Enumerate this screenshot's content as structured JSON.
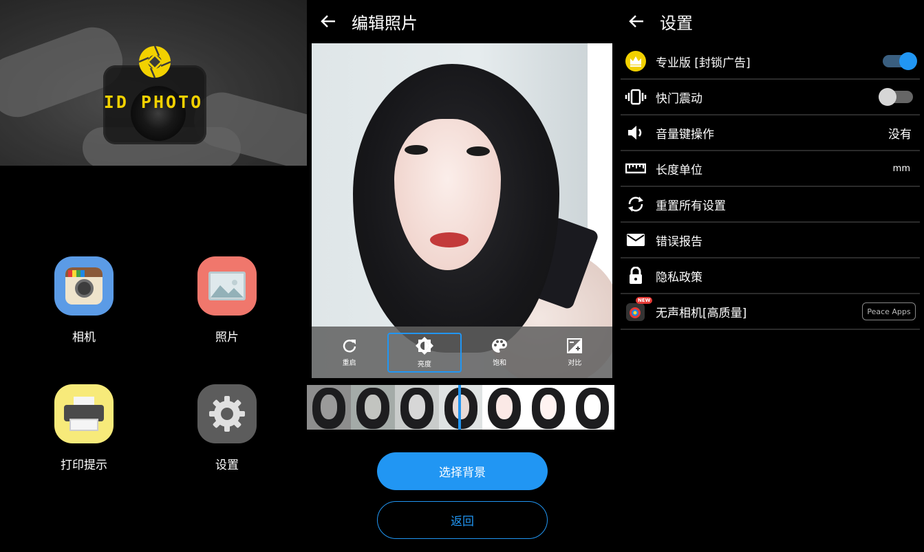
{
  "home": {
    "logo_text": "ID PHOTO",
    "apps": [
      {
        "label": "相机",
        "icon": "camera-app-icon"
      },
      {
        "label": "照片",
        "icon": "photos-app-icon"
      },
      {
        "label": "打印提示",
        "icon": "printer-app-icon"
      },
      {
        "label": "设置",
        "icon": "settings-app-icon"
      }
    ]
  },
  "editor": {
    "title": "编辑照片",
    "tools": [
      {
        "label": "重启",
        "icon": "reset-icon"
      },
      {
        "label": "亮度",
        "icon": "brightness-icon",
        "active": true
      },
      {
        "label": "饱和",
        "icon": "palette-icon"
      },
      {
        "label": "对比",
        "icon": "contrast-icon"
      }
    ],
    "filters_count": 7,
    "select_bg_label": "选择背景",
    "back_label": "返回"
  },
  "settings": {
    "title": "设置",
    "rows": [
      {
        "label": "专业版 [封锁广告]",
        "icon": "crown-icon",
        "control": "toggle",
        "on": true
      },
      {
        "label": "快门震动",
        "icon": "vibrate-icon",
        "control": "toggle",
        "on": false
      },
      {
        "label": "音量键操作",
        "icon": "volume-icon",
        "value": "没有"
      },
      {
        "label": "长度单位",
        "icon": "ruler-icon",
        "value": "mm"
      },
      {
        "label": "重置所有设置",
        "icon": "sync-icon"
      },
      {
        "label": "错误报告",
        "icon": "mail-icon"
      },
      {
        "label": "隐私政策",
        "icon": "lock-icon"
      },
      {
        "label": "无声相机[高质量]",
        "icon": "silent-camera-app-icon",
        "badge": "NEW",
        "tag": "Peace Apps"
      }
    ]
  },
  "colors": {
    "accent": "#2196f3",
    "logo_yellow": "#f2d100"
  }
}
